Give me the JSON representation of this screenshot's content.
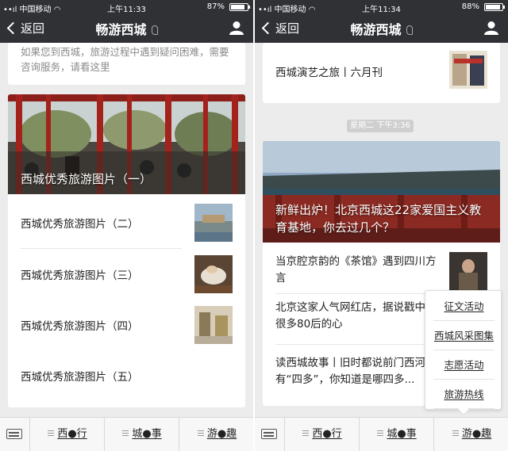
{
  "left": {
    "status": {
      "carrier": "中国移动",
      "time": "上午11:33",
      "battery": "87%",
      "battery_level": 0.87
    },
    "nav": {
      "back_label": "返回",
      "title": "畅游西城"
    },
    "hint_text": "如果您到西城，旅游过程中遇到疑问困难，需要咨询服务，请看这里",
    "hero_caption": "西城优秀旅游图片（一）",
    "items": [
      {
        "label": "西城优秀旅游图片（二）"
      },
      {
        "label": "西城优秀旅游图片（三）"
      },
      {
        "label": "西城优秀旅游图片（四）"
      },
      {
        "label": "西城优秀旅游图片（五）"
      }
    ],
    "tabs": [
      "西●行",
      "城●事",
      "游●趣"
    ]
  },
  "right": {
    "status": {
      "carrier": "中国移动",
      "time": "上午11:34",
      "battery": "88%",
      "battery_level": 0.88
    },
    "nav": {
      "back_label": "返回",
      "title": "畅游西城"
    },
    "top_item": "西城演艺之旅丨六月刊",
    "timestamp": "星期二 下午3:36",
    "hero_caption": "新鲜出炉！北京西城这22家爱国主义教育基地，你去过几个？",
    "items": [
      {
        "label": "当京腔京韵的《茶馆》遇到四川方言"
      },
      {
        "label": "北京这家人气网红店，据说戳中了很多80后的心"
      },
      {
        "label": "读西城故事丨旧时都说前门西河沿有“四多”，你知道是哪四多..."
      }
    ],
    "popup_menu": [
      "征文活动",
      "西城风采图集",
      "志愿活动",
      "旅游热线"
    ],
    "tabs": [
      "西●行",
      "城●事",
      "游●趣"
    ]
  }
}
